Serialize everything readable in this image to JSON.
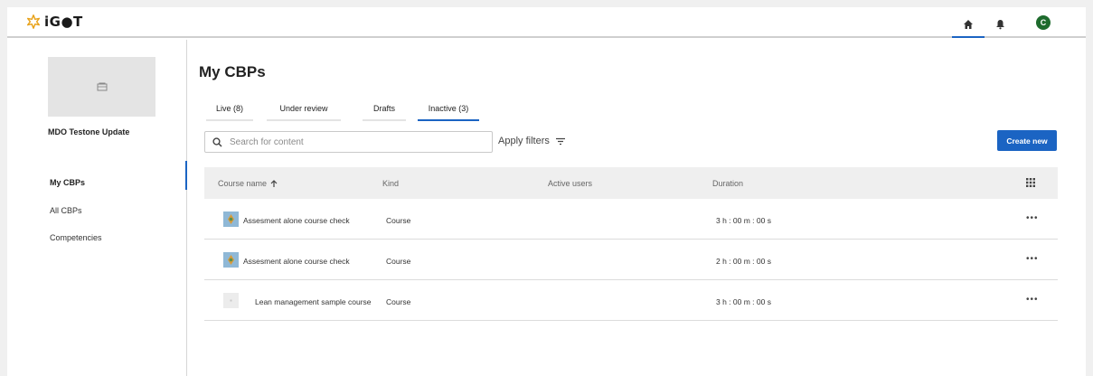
{
  "header": {
    "logo_text": "iG●T",
    "avatar_initial": "C",
    "home_icon": "home-icon",
    "bell_icon": "bell-icon",
    "accent": "#1b64c3",
    "avatar_color": "#1e6b2d"
  },
  "sidebar": {
    "org_name": "MDO Testone Update",
    "items": [
      {
        "label": "My CBPs",
        "active": true
      },
      {
        "label": "All CBPs",
        "active": false
      },
      {
        "label": "Competencies",
        "active": false
      }
    ]
  },
  "main": {
    "title": "My CBPs",
    "tabs": [
      {
        "label": "Live (8)",
        "active": false
      },
      {
        "label": "Under review",
        "active": false
      },
      {
        "label": "Drafts",
        "active": false
      },
      {
        "label": "Inactive (3)",
        "active": true
      }
    ],
    "search_placeholder": "Search for content",
    "filters_label": "Apply filters",
    "create_label": "Create new"
  },
  "table": {
    "columns": [
      "Course name",
      "Kind",
      "Active users",
      "Duration"
    ],
    "rows": [
      {
        "name": "Assesment alone course check",
        "kind": "Course",
        "active_users": "",
        "duration": "3 h : 00 m : 00 s",
        "thumb": "image"
      },
      {
        "name": "Assesment alone course check",
        "kind": "Course",
        "active_users": "",
        "duration": "2 h : 00 m : 00 s",
        "thumb": "image"
      },
      {
        "name": "Lean management sample course",
        "kind": "Course",
        "active_users": "",
        "duration": "3 h : 00 m : 00 s",
        "thumb": "placeholder"
      }
    ],
    "more_label": "•••"
  }
}
